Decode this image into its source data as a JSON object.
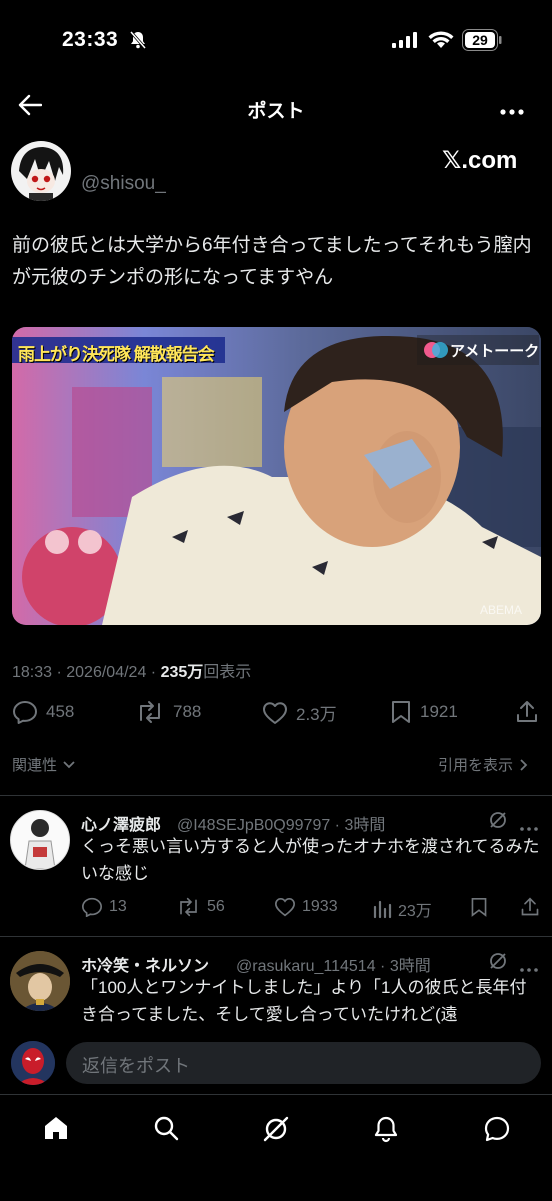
{
  "status_bar": {
    "time": "23:33",
    "battery": "29"
  },
  "nav": {
    "title": "ポスト"
  },
  "post": {
    "handle": "@shisou_",
    "watermark": "𝕏.com",
    "text": "前の彼氏とは大学から6年付き合ってましたってそれもう膣内が元彼のチンポの形になってますやん",
    "media": {
      "banner_text": "雨上がり決死隊 解散報告会",
      "channel_logo": "アメトーーク",
      "corner_mark": "ABEMA"
    },
    "timestamp": "18:33 · 2026/04/24 · ",
    "views_count": "235万",
    "views_label": "回表示",
    "stats": {
      "replies": "458",
      "reposts": "788",
      "likes": "2.3万",
      "bookmarks": "1921"
    },
    "sort_label": "関連性",
    "quotes_label": "引用を表示"
  },
  "replies": [
    {
      "name": "心ノ澤疲郎",
      "handle": "@I48SEJpB0Q99797 · 3時間",
      "text": "くっそ悪い言い方すると人が使ったオナホを渡されてるみたいな感じ",
      "replies": "13",
      "reposts": "56",
      "likes": "1933",
      "views": "23万"
    },
    {
      "name": "ホ冷笑・ネルソン",
      "handle": "@rasukaru_114514 · 3時間",
      "text": "「100人とワンナイトしました」より「1人の彼氏と長年付き合ってました、そして愛し合っていたけれど(遠"
    }
  ],
  "composer": {
    "placeholder": "返信をポスト"
  },
  "colors": {
    "background": "#000000",
    "text": "#e7e9ea",
    "muted": "#71767b",
    "divider": "#2f3336"
  }
}
